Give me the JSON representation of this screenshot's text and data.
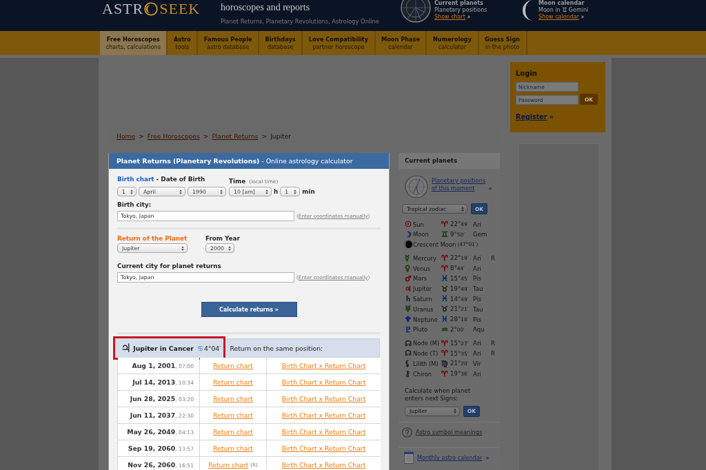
{
  "header": {
    "logo": {
      "left": "ASTR",
      "right": "SEEK"
    },
    "tagline": "horoscopes and reports",
    "subtitle": "Planet Returns, Planetary Revolutions, Astrology Online",
    "widgets": [
      {
        "kind": "chart",
        "title": "Current planets",
        "text": "Planetary positions",
        "link": "Show chart",
        "arrow": "»"
      },
      {
        "kind": "moon",
        "title": "Moon calendar",
        "text": "Moon in",
        "sign": "♊",
        "sign_name": "Gemini",
        "link": "Show calendar",
        "arrow": "»"
      }
    ]
  },
  "nav": [
    {
      "title": "Free Horoscopes",
      "subtitle": "charts, calculations",
      "selected": true
    },
    {
      "title": "Astro",
      "subtitle": "tools",
      "selected": false
    },
    {
      "title": "Famous People",
      "subtitle": "astro database",
      "selected": false
    },
    {
      "title": "Birthdays",
      "subtitle": "database",
      "selected": false
    },
    {
      "title": "Love Compatibility",
      "subtitle": "partner horoscope",
      "selected": false
    },
    {
      "title": "Moon Phase",
      "subtitle": "calendar",
      "selected": false
    },
    {
      "title": "Numerology",
      "subtitle": "calculator",
      "selected": false
    },
    {
      "title": "Guess Sign",
      "subtitle": "in the photo",
      "selected": false
    }
  ],
  "breadcrumb": [
    {
      "kind": "link",
      "label": "Home"
    },
    {
      "kind": "separator",
      "label": ">"
    },
    {
      "kind": "link",
      "label": "Free Horoscopes"
    },
    {
      "kind": "separator",
      "label": ">"
    },
    {
      "kind": "link",
      "label": "Planet Returns"
    },
    {
      "kind": "separator",
      "label": ">"
    },
    {
      "kind": "current",
      "label": "Jupiter"
    }
  ],
  "panel": {
    "title": "**Planet Returns (Planetary Revolutions)** - Online astrology calculator",
    "birth_date": {
      "link": "Birth chart",
      "label": "- Date of Birth",
      "selects": [
        {
          "kind": "day",
          "value": "1"
        },
        {
          "kind": "month",
          "value": "April"
        },
        {
          "kind": "year",
          "value": "1990"
        }
      ]
    },
    "birth_time": {
      "label": "Time",
      "hint": "(local time)",
      "selects": [
        {
          "kind": "hour",
          "value": "10 [am]",
          "unit": "h"
        },
        {
          "kind": "minute",
          "value": "1",
          "unit": "min"
        }
      ]
    },
    "birth_city": {
      "label": "Birth city:",
      "value": "Tokyo, Japan",
      "hint": {
        "open": "(",
        "link": "Enter coordinates manually",
        "close": ")"
      }
    },
    "planet": {
      "label": "Return of the Planet",
      "select": {
        "kind": "planet",
        "value": "Jupiter"
      }
    },
    "from_year": {
      "label": "From Year",
      "select": {
        "kind": "year_from",
        "value": "2000"
      }
    },
    "current_city": {
      "label": "Current city for planet returns",
      "value": "Tokyo, Japan",
      "hint": {
        "open": "(",
        "link": "Enter coordinates manually",
        "close": ")"
      }
    },
    "submit": "Calculate returns »",
    "results": {
      "highlighted": true,
      "planet_symbol": "♃",
      "title": "Jupiter in Cancer",
      "sign_symbol": "♋",
      "position": "4°04′",
      "note": "Return on the same position:",
      "rows": [
        {
          "date": "**Aug 1, 2001**, 07:00",
          "return_link": "Return chart",
          "compare_link": "Birth Chart x Return Chart"
        },
        {
          "date": "**Jul 14, 2013**, 10:34",
          "return_link": "Return chart",
          "compare_link": "Birth Chart x Return Chart"
        },
        {
          "date": "**Jun 28, 2025**, 03:20",
          "return_link": "Return chart",
          "compare_link": "Birth Chart x Return Chart"
        },
        {
          "date": "**Jun 11, 2037**, 22:30",
          "return_link": "Return chart",
          "compare_link": "Birth Chart x Return Chart"
        },
        {
          "date": "**May 26, 2049**, 04:13",
          "return_link": "Return chart",
          "compare_link": "Birth Chart x Return Chart"
        },
        {
          "date": "**Sep 19, 2060**, 13:57",
          "return_link": "Return chart",
          "compare_link": "Birth Chart x Return Chart"
        },
        {
          "date": "**Nov 26, 2060**, 16:51",
          "return_link": "Return chart",
          "flag": "(R)",
          "compare_link": "Birth Chart x Return Chart"
        }
      ]
    }
  },
  "sidebar": {
    "title": "Current planets",
    "link": "Planetary positions of this moment",
    "arrow": "»",
    "zodiac": {
      "kind": "zodiac",
      "value": "Tropical zodiac"
    },
    "zodiac_ok": "OK",
    "groups": [
      {
        "items": [
          {
            "kind": "planet",
            "symbol": {
              "glyph": "☉",
              "color": "#700a0a"
            },
            "name": "Sun",
            "sign": {
              "glyph": "♈",
              "color": "#700a0a"
            },
            "deg": "22°",
            "min": "49′",
            "abbr": "Ari"
          },
          {
            "kind": "planet",
            "symbol": {
              "glyph": "☽",
              "color": "#14207a"
            },
            "name": "Moon",
            "sign": {
              "glyph": "♊",
              "color": "#17400c"
            },
            "deg": "9°",
            "min": "50′",
            "abbr": "Gem"
          },
          {
            "kind": "phase",
            "name": "Crescent Moon",
            "extra": "(47°01′)"
          }
        ]
      },
      {
        "items": [
          {
            "kind": "planet",
            "symbol": {
              "glyph": "☿",
              "color": "#17400c"
            },
            "name": "Mercury",
            "sign": {
              "glyph": "♈",
              "color": "#700a0a"
            },
            "deg": "22°",
            "min": "19′",
            "abbr": "Ari",
            "retro": "R"
          },
          {
            "kind": "planet",
            "symbol": {
              "glyph": "♀",
              "color": "#17400c"
            },
            "name": "Venus",
            "sign": {
              "glyph": "♈",
              "color": "#700a0a"
            },
            "deg": "8°",
            "min": "44′",
            "abbr": "Ari"
          },
          {
            "kind": "planet",
            "symbol": {
              "glyph": "♂",
              "color": "#700a0a"
            },
            "name": "Mars",
            "sign": {
              "glyph": "♓",
              "color": "#0a3560"
            },
            "deg": "15°",
            "min": "45′",
            "abbr": "Pis"
          },
          {
            "kind": "planet",
            "symbol": {
              "glyph": "♃",
              "color": "#6a1414"
            },
            "name": "Jupiter",
            "sign": {
              "glyph": "♉",
              "color": "#262626"
            },
            "deg": "19°",
            "min": "49′",
            "abbr": "Tau"
          },
          {
            "kind": "planet",
            "symbol": {
              "glyph": "♄",
              "color": "#262626"
            },
            "name": "Saturn",
            "sign": {
              "glyph": "♓",
              "color": "#0a3560"
            },
            "deg": "14°",
            "min": "49′",
            "abbr": "Pis"
          },
          {
            "kind": "planet",
            "symbol": {
              "glyph": "♅",
              "color": "#17400c"
            },
            "name": "Uranus",
            "sign": {
              "glyph": "♉",
              "color": "#262626"
            },
            "deg": "21°",
            "min": "21′",
            "abbr": "Tau"
          },
          {
            "kind": "planet",
            "symbol": {
              "glyph": "♆",
              "color": "#14207a"
            },
            "name": "Neptune",
            "sign": {
              "glyph": "♓",
              "color": "#0a3560"
            },
            "deg": "28°",
            "min": "18′",
            "abbr": "Pis"
          },
          {
            "kind": "planet",
            "symbol": {
              "glyph": "♇",
              "color": "#14207a"
            },
            "name": "Pluto",
            "sign": {
              "glyph": "♒",
              "color": "#17400c"
            },
            "deg": "2°",
            "min": "00′",
            "abbr": "Aqu"
          }
        ]
      },
      {
        "items": [
          {
            "kind": "planet",
            "symbol": {
              "glyph": "☊",
              "color": "#262626"
            },
            "name": "Node (M)",
            "sign": {
              "glyph": "♈",
              "color": "#700a0a"
            },
            "deg": "15°",
            "min": "27′",
            "abbr": "Ari",
            "retro": "R"
          },
          {
            "kind": "planet",
            "symbol": {
              "glyph": "☊",
              "color": "#262626"
            },
            "name": "Node (T)",
            "sign": {
              "glyph": "♈",
              "color": "#700a0a"
            },
            "deg": "15°",
            "min": "35′",
            "abbr": "Ari",
            "retro": "R"
          },
          {
            "kind": "planet",
            "symbol": {
              "glyph": "⚸",
              "color": "#1a1a1a"
            },
            "name": "Lilith (M)",
            "sign": {
              "glyph": "♍",
              "color": "#262626"
            },
            "deg": "21°",
            "min": "20′",
            "abbr": "Vir"
          },
          {
            "kind": "planet",
            "symbol": {
              "glyph": "⚷",
              "color": "#262626"
            },
            "name": "Chiron",
            "sign": {
              "glyph": "♈",
              "color": "#700a0a"
            },
            "deg": "19°",
            "min": "36′",
            "abbr": "Ari"
          }
        ]
      }
    ],
    "calc": {
      "text": "Calculate when planet enters next Signs:",
      "select": {
        "kind": "planet_small",
        "value": "Jupiter"
      },
      "ok": "OK"
    },
    "links": [
      {
        "kind": "help",
        "label": "Astro symbol meanings"
      },
      {
        "kind": "calendar",
        "label": "Monthly astro calendar",
        "arrow": "»"
      }
    ]
  },
  "login": {
    "title": "Login",
    "nickname": {
      "placeholder": "Nickname"
    },
    "password": {
      "placeholder": "Password"
    },
    "ok": "OK",
    "register": "Register",
    "arrow": "»"
  }
}
